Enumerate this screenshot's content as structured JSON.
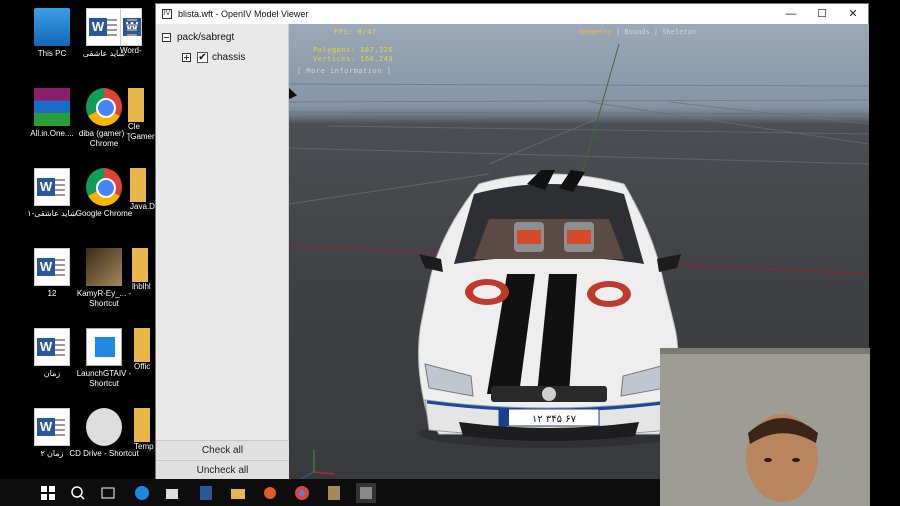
{
  "desktop": {
    "icons": [
      {
        "label": "This PC",
        "icon": "this-pc-icon"
      },
      {
        "label": "شاید عاشقی",
        "icon": "word-doc-icon"
      },
      {
        "label": "Word-",
        "icon": "word-doc-icon"
      },
      {
        "label": "All.in.One....",
        "icon": "winrar-icon"
      },
      {
        "label": "diba (gamer) - Chrome",
        "icon": "chrome-icon"
      },
      {
        "label": "Cle [Gamer",
        "icon": "folder-icon"
      },
      {
        "label": "شاید عاشقی-۱",
        "icon": "word-doc-icon"
      },
      {
        "label": "Google Chrome",
        "icon": "chrome-icon"
      },
      {
        "label": "Java.D",
        "icon": "folder-icon"
      },
      {
        "label": "12",
        "icon": "word-doc-icon"
      },
      {
        "label": "KamyR-Ey_... - Shortcut",
        "icon": "game-shortcut-icon"
      },
      {
        "label": "lhblhl",
        "icon": "folder-icon"
      },
      {
        "label": "زمان",
        "icon": "word-doc-icon"
      },
      {
        "label": "LaunchGTAIV - Shortcut",
        "icon": "launcher-icon"
      },
      {
        "label": "Offic",
        "icon": "folder-icon"
      },
      {
        "label": "زمان ۲",
        "icon": "word-doc-icon"
      },
      {
        "label": "CD Drive - Shortcut",
        "icon": "dvd-drive-icon"
      },
      {
        "label": "Temp",
        "icon": "folder-icon"
      }
    ]
  },
  "window": {
    "title": "blista.wft - OpenIV Model Viewer",
    "minimize": "—",
    "maximize": "☐",
    "close": "✕"
  },
  "tree": {
    "root_label": "pack/sabregt",
    "child_label": "chassis",
    "child_checked": "✔"
  },
  "panel_buttons": {
    "check_all": "Check all",
    "uncheck_all": "Uncheck all"
  },
  "hud": {
    "fps": "FPS: 8/47",
    "polygons": "Polygons: 187,326",
    "vertices": "Vertices: 166,243",
    "more_info": "[ More information ]",
    "tabs": [
      "Geometry",
      "Bounds",
      "Skeleton"
    ],
    "active_tab": "Geometry"
  },
  "car": {
    "plate": "۱۲ ۳۴۵ ۶۷"
  },
  "colors": {
    "hud_yellow": "#e8d24a",
    "tab_active": "#f4b63a",
    "panel_bg": "#e9e9ea",
    "car_body": "#f2f2f2",
    "stripe": "#111111",
    "logo_red": "#c0392b"
  }
}
